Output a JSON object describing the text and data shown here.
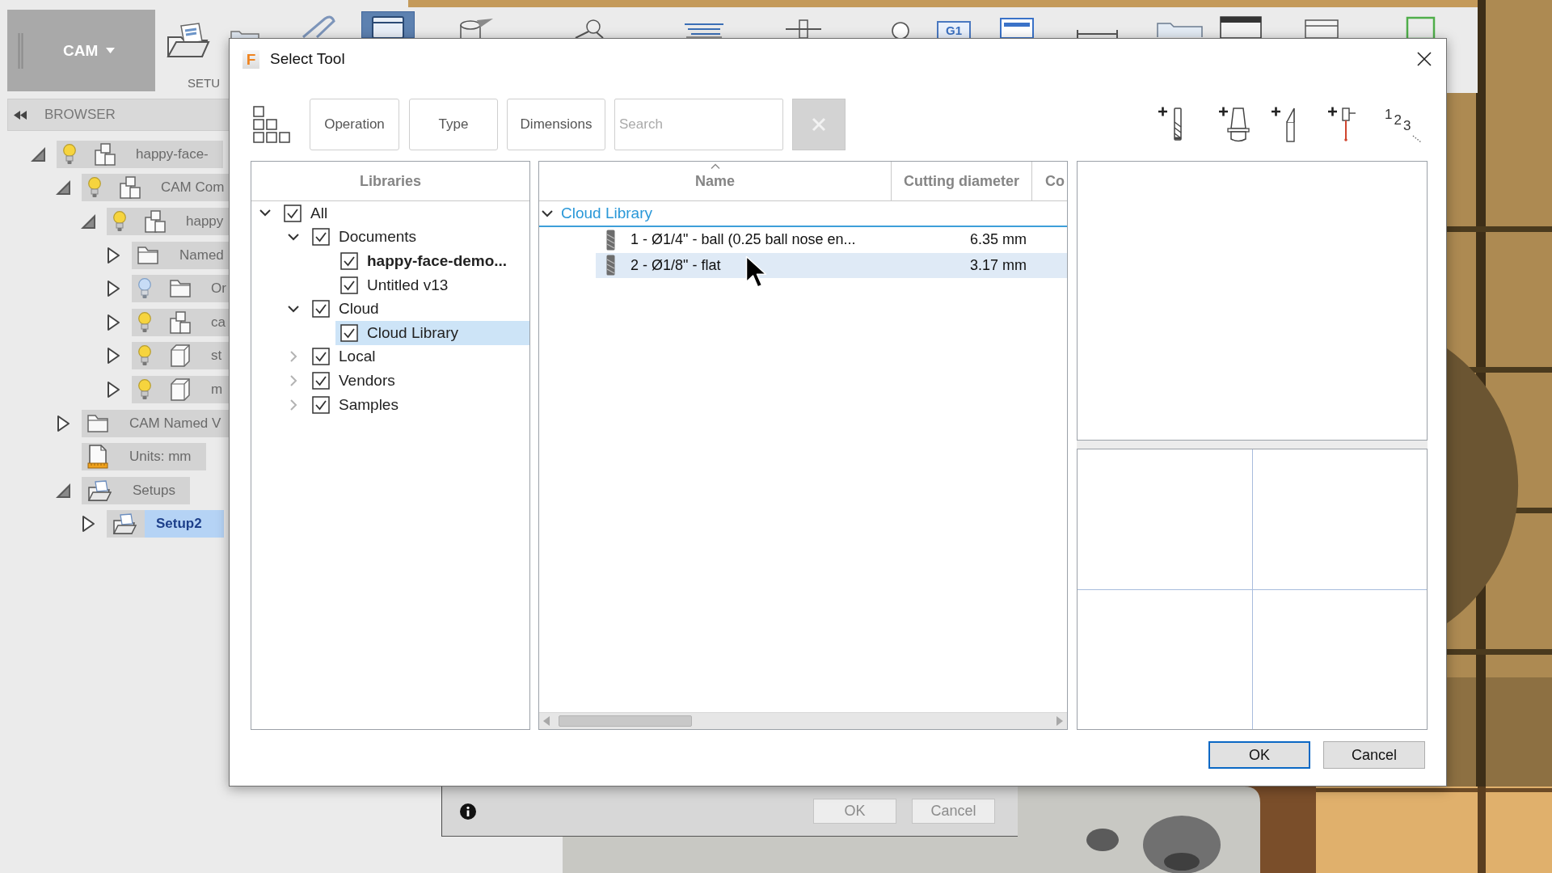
{
  "toolbar": {
    "workspace": "CAM",
    "setup_label": "SETU",
    "badge": "G1"
  },
  "browser": {
    "title": "BROWSER",
    "tree": [
      {
        "label": "happy-face-",
        "kind": "component",
        "visible": true,
        "expanded": true,
        "selected": false,
        "children": [
          {
            "label": "CAM Com",
            "kind": "component",
            "visible": true,
            "expanded": true,
            "selected": false,
            "children": [
              {
                "label": "happy",
                "kind": "component",
                "visible": true,
                "expanded": true,
                "selected": false,
                "children": [
                  {
                    "label": "Named",
                    "kind": "folder",
                    "expanded": false,
                    "selected": false
                  },
                  {
                    "label": "Or",
                    "kind": "folder",
                    "visible": false,
                    "expanded": false,
                    "selected": false
                  },
                  {
                    "label": "ca",
                    "kind": "component",
                    "visible": true,
                    "expanded": false,
                    "selected": false
                  },
                  {
                    "label": "st",
                    "kind": "body",
                    "visible": true,
                    "expanded": false,
                    "selected": false
                  },
                  {
                    "label": "m",
                    "kind": "body",
                    "visible": true,
                    "expanded": false,
                    "selected": false
                  }
                ]
              }
            ]
          },
          {
            "label": "CAM Named V",
            "kind": "folder",
            "expanded": false,
            "selected": false
          },
          {
            "label": "Units: mm",
            "kind": "units",
            "selected": false
          },
          {
            "label": "Setups",
            "kind": "setups",
            "expanded": true,
            "selected": false,
            "children": [
              {
                "label": "Setup2",
                "kind": "setups",
                "expanded": false,
                "selected": true
              }
            ]
          }
        ]
      }
    ]
  },
  "dialog": {
    "app_icon": "F",
    "title": "Select Tool",
    "filters": [
      "Operation",
      "Type",
      "Dimensions"
    ],
    "search": {
      "placeholder": "Search"
    },
    "clear_button": {
      "disabled": true
    },
    "numbering_digits": [
      "1",
      "2",
      "3"
    ],
    "libraries": {
      "title": "Libraries",
      "tree": [
        {
          "label": "All",
          "checked": true,
          "expanded": true,
          "selected": false,
          "current": false,
          "children": [
            {
              "label": "Documents",
              "checked": true,
              "expanded": true,
              "selected": false,
              "current": false,
              "children": [
                {
                  "label": "happy-face-demo...",
                  "checked": true,
                  "selected": false,
                  "current": true
                },
                {
                  "label": "Untitled v13",
                  "checked": true,
                  "selected": false,
                  "current": false
                }
              ]
            },
            {
              "label": "Cloud",
              "checked": true,
              "expanded": true,
              "selected": false,
              "current": false,
              "children": [
                {
                  "label": "Cloud Library",
                  "checked": true,
                  "selected": true,
                  "current": false
                }
              ]
            },
            {
              "label": "Local",
              "checked": true,
              "expanded": false,
              "selected": false,
              "current": false
            },
            {
              "label": "Vendors",
              "checked": true,
              "expanded": false,
              "selected": false,
              "current": false
            },
            {
              "label": "Samples",
              "checked": true,
              "expanded": false,
              "selected": false,
              "current": false
            }
          ]
        }
      ]
    },
    "tools": {
      "columns": [
        {
          "label": "Name",
          "sorted": true
        },
        {
          "label": "Cutting diameter",
          "sorted": false
        },
        {
          "label": "Co",
          "sorted": false
        }
      ],
      "groups": [
        {
          "label": "Cloud Library",
          "expanded": true,
          "rows": [
            {
              "name": "1 - Ø1/4\" - ball (0.25 ball nose en...",
              "cutting_diameter": "6.35 mm",
              "selected": false
            },
            {
              "name": "2 - Ø1/8\" - flat",
              "cutting_diameter": "3.17 mm",
              "selected": true
            }
          ]
        }
      ]
    },
    "buttons": [
      {
        "label": "OK",
        "default": true
      },
      {
        "label": "Cancel",
        "default": false
      }
    ]
  },
  "background_dialog": {
    "buttons": [
      {
        "label": "OK",
        "disabled": true
      },
      {
        "label": "Cancel",
        "disabled": true
      }
    ]
  }
}
